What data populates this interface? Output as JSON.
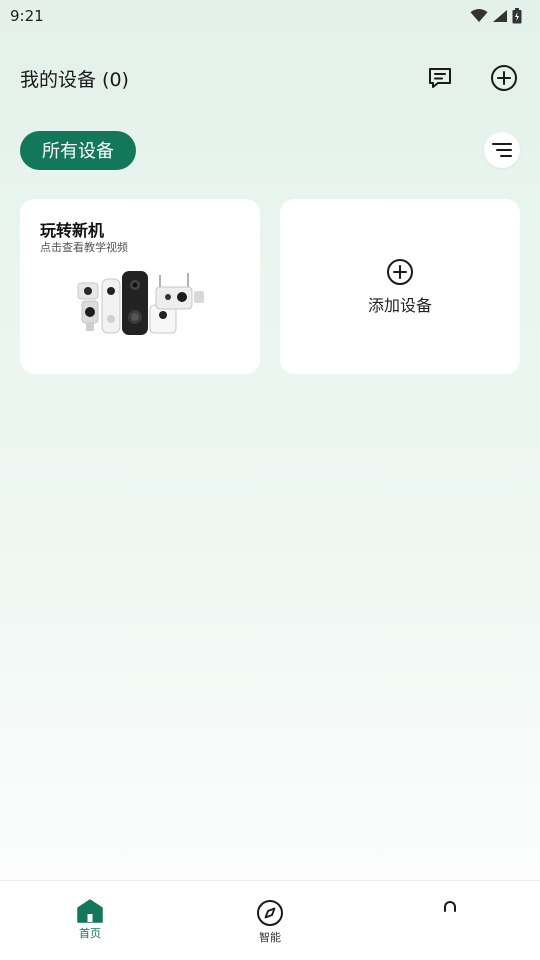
{
  "status_bar": {
    "time": "9:21"
  },
  "header": {
    "title": "我的设备 (0)",
    "message_icon": "message-icon",
    "add_icon": "add-circle-icon"
  },
  "filter": {
    "chip_label": "所有设备",
    "sort_icon": "sort-icon"
  },
  "cards": {
    "promo": {
      "title": "玩转新机",
      "subtitle": "点击查看教学视频"
    },
    "add_device": {
      "label": "添加设备"
    }
  },
  "bottom_nav": {
    "items": [
      {
        "label": "首页",
        "icon": "home-icon",
        "active": true
      },
      {
        "label": "智能",
        "icon": "compass-icon",
        "active": false
      },
      {
        "label": "",
        "icon": "profile-icon",
        "active": false
      }
    ]
  },
  "colors": {
    "accent": "#13775a",
    "background_top": "#e3f1ea",
    "card": "#ffffff"
  }
}
